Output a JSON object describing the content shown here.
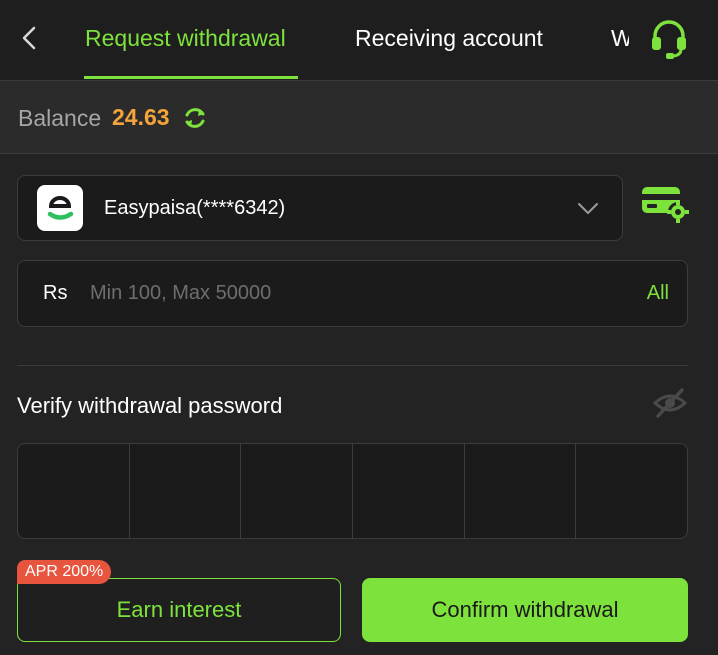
{
  "header": {
    "back_icon": "chevron-left-icon",
    "tabs": [
      {
        "label": "Request withdrawal",
        "active": true
      },
      {
        "label": "Receiving account",
        "active": false
      },
      {
        "label": "W",
        "active": false
      }
    ],
    "support_icon": "headset-icon"
  },
  "balance": {
    "label": "Balance",
    "value": "24.63",
    "refresh_icon": "refresh-icon"
  },
  "account": {
    "name": "Easypaisa(****6342)",
    "logo_icon": "easypaisa-logo",
    "dropdown_icon": "chevron-down-icon",
    "settings_icon": "card-settings-icon"
  },
  "amount": {
    "currency": "Rs",
    "placeholder": "Min 100, Max 50000",
    "all_label": "All"
  },
  "password": {
    "label": "Verify withdrawal password",
    "visibility_icon": "eye-off-icon",
    "digits": 6
  },
  "actions": {
    "badge": "APR 200%",
    "earn_label": "Earn interest",
    "confirm_label": "Confirm withdrawal"
  },
  "colors": {
    "accent": "#7ee23c",
    "balance": "#f4a43a",
    "badge": "#e8553f",
    "background": "#232323"
  }
}
